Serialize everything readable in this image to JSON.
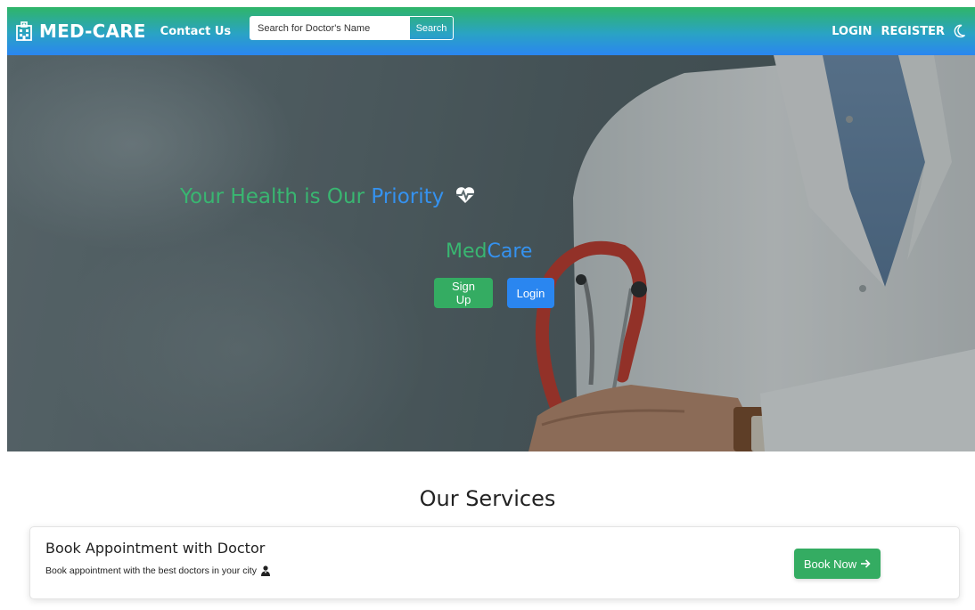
{
  "navbar": {
    "brand": "MED-CARE",
    "contact_label": "Contact Us",
    "search_placeholder": "Search for Doctor's Name",
    "search_button": "Search",
    "login_label": "LOGIN",
    "register_label": "REGISTER",
    "icons": {
      "brand": "hospital-icon",
      "theme": "moon-icon"
    }
  },
  "hero": {
    "title_part1": "Your Health is Our ",
    "title_part2": "Priority",
    "brand_part1": "Med",
    "brand_part2": "Care",
    "signup_button": "Sign Up",
    "login_button": "Login",
    "icons": {
      "title": "heart-pulse-icon"
    }
  },
  "services": {
    "heading": "Our Services",
    "items": [
      {
        "title": "Book Appointment with Doctor",
        "description": "Book appointment with the best doctors in your city",
        "button": "Book Now",
        "icons": {
          "description": "doctor-icon",
          "button": "arrow-right-icon"
        }
      }
    ]
  },
  "colors": {
    "green": "#34ac62",
    "blue": "#2a86f0",
    "navbar_top": "#2fb568",
    "navbar_bottom": "#2a86f0"
  }
}
